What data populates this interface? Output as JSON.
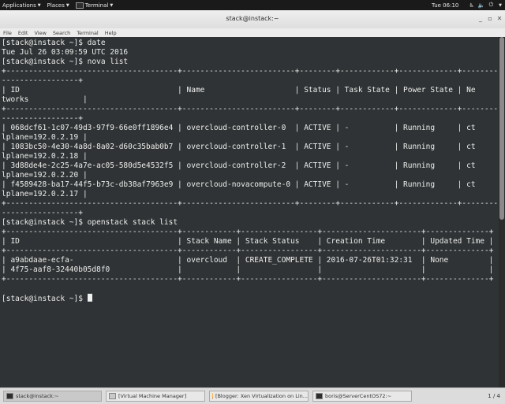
{
  "topbar": {
    "applications": "Applications",
    "places": "Places",
    "terminal": "Terminal",
    "clock": "Tue 06:10"
  },
  "window": {
    "title": "stack@instack:~"
  },
  "menubar": [
    "File",
    "Edit",
    "View",
    "Search",
    "Terminal",
    "Help"
  ],
  "terminal": {
    "lines": [
      "[stack@instack ~]$ date",
      "Tue Jul 26 03:09:59 UTC 2016",
      "[stack@instack ~]$ nova list",
      "+--------------------------------------+-------------------------+--------+------------+-------------+---------",
      "-----------------+",
      "| ID                                   | Name                    | Status | Task State | Power State | Ne",
      "tworks            |",
      "+--------------------------------------+-------------------------+--------+------------+-------------+---------",
      "-----------------+",
      "| 068dcf61-1c07-49d3-97f9-66e0ff1896e4 | overcloud-controller-0  | ACTIVE | -          | Running     | ct",
      "lplane=192.0.2.19 |",
      "| 1083bc50-4e30-4a8d-8a02-d60c35bab0b7 | overcloud-controller-1  | ACTIVE | -          | Running     | ct",
      "lplane=192.0.2.18 |",
      "| 3d88de4e-2c25-4a7e-ac05-580d5e4532f5 | overcloud-controller-2  | ACTIVE | -          | Running     | ct",
      "lplane=192.0.2.20 |",
      "| f4589428-ba17-44f5-b73c-db38af7963e9 | overcloud-novacompute-0 | ACTIVE | -          | Running     | ct",
      "lplane=192.0.2.17 |",
      "+--------------------------------------+-------------------------+--------+------------+-------------+---------",
      "-----------------+",
      "[stack@instack ~]$ openstack stack list",
      "+--------------------------------------+------------+-----------------+----------------------+--------------+",
      "| ID                                   | Stack Name | Stack Status    | Creation Time        | Updated Time |",
      "+--------------------------------------+------------+-----------------+----------------------+--------------+",
      "| a9abdaae-ecfa-                       | overcloud  | CREATE_COMPLETE | 2016-07-26T01:32:31  | None         |",
      "| 4f75-aaf8-32440b05d8f0               |            |                 |                      |              |",
      "+--------------------------------------+------------+-----------------+----------------------+--------------+"
    ],
    "prompt": "[stack@instack ~]$ "
  },
  "taskbar": {
    "tasks": [
      "stack@instack:~",
      "[Virtual Machine Manager]",
      "[Blogger: Xen Virtualization on Lin...",
      "boris@ServerCentOS72:~"
    ],
    "workspace": "1 / 4"
  }
}
